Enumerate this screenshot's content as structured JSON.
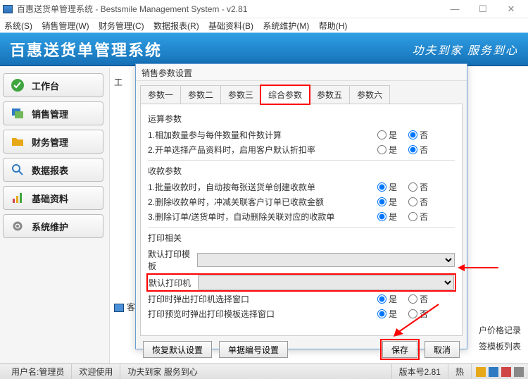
{
  "window": {
    "title": "百惠送货单管理系统 - Bestsmile Management System - v2.81"
  },
  "menubar": [
    "系统(S)",
    "销售管理(W)",
    "财务管理(C)",
    "数据报表(R)",
    "基础资料(B)",
    "系统维护(M)",
    "帮助(H)"
  ],
  "banner": {
    "title": "百惠送货单管理系统",
    "slogan": "功夫到家 服务到心"
  },
  "sidebar": [
    {
      "name": "worktable",
      "label": "工作台",
      "color": "#3fa63f"
    },
    {
      "name": "sales",
      "label": "销售管理",
      "color": "#2e7bc4"
    },
    {
      "name": "finance",
      "label": "财务管理",
      "color": "#e6a817"
    },
    {
      "name": "reports",
      "label": "数据报表",
      "color": "#2e7bc4"
    },
    {
      "name": "basedata",
      "label": "基础资料",
      "color": "#d04545"
    },
    {
      "name": "maintain",
      "label": "系统维护",
      "color": "#888"
    }
  ],
  "main_truncated": {
    "tab_prefix": "工",
    "row1_suffix": "客",
    "row2_suffix": "户价格记录",
    "row3_suffix": "签模板列表"
  },
  "dialog": {
    "title": "销售参数设置",
    "tabs": [
      "参数一",
      "参数二",
      "参数三",
      "综合参数",
      "参数五",
      "参数六"
    ],
    "active_tab": 3,
    "yes": "是",
    "no": "否",
    "sections": {
      "calc": {
        "title": "运算参数",
        "rows": [
          {
            "text": "1.相加数量参与每件数量和件数计算",
            "value": "no"
          },
          {
            "text": "2.开单选择产品资料时，启用客户默认折扣率",
            "value": "no"
          }
        ]
      },
      "receipt": {
        "title": "收款参数",
        "rows": [
          {
            "text": "1.批量收款时，自动按每张送货单创建收款单",
            "value": "yes"
          },
          {
            "text": "2.删除收款单时，冲减关联客户订单已收款金额",
            "value": "yes"
          },
          {
            "text": "3.删除订单/送货单时，自动删除关联对应的收款单",
            "value": "yes"
          }
        ]
      },
      "print": {
        "title": "打印相关",
        "template_label": "默认打印模板",
        "printer_label": "默认打印机",
        "rows": [
          {
            "text": "打印时弹出打印机选择窗口",
            "value": "yes"
          },
          {
            "text": "打印预览时弹出打印模板选择窗口",
            "value": "yes"
          }
        ]
      }
    },
    "buttons": {
      "restore": "恢复默认设置",
      "numbering": "单据编号设置",
      "save": "保存",
      "cancel": "取消"
    }
  },
  "statusbar": {
    "user": "用户名:管理员",
    "welcome": "欢迎使用",
    "slogan": "功夫到家 服务到心",
    "version": "版本号2.81",
    "trailing": "热"
  }
}
